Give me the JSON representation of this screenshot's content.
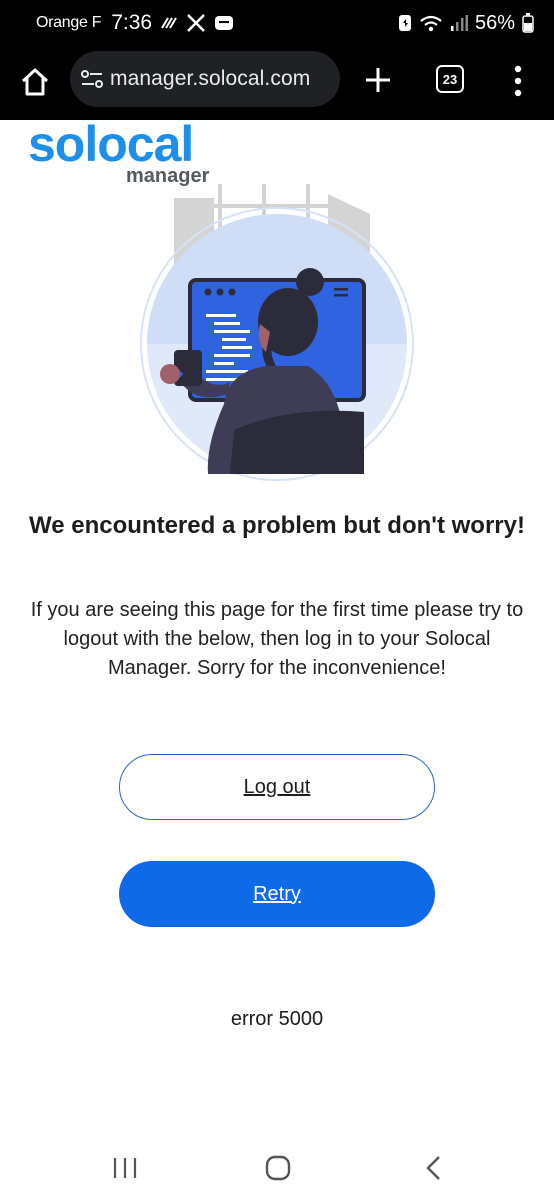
{
  "status_bar": {
    "carrier": "Orange F",
    "time": "7:36",
    "battery": "56%"
  },
  "browser": {
    "url": "manager.solocal.com",
    "tab_count": "23"
  },
  "logo": {
    "brand": "solocal",
    "product": "manager"
  },
  "error_page": {
    "heading": "We encountered a problem but don't worry!",
    "message": "If you are seeing this page for the first time please try to logout with the below, then log in to your Solocal Manager. Sorry for the inconvenience!",
    "logout_label": "Log out",
    "retry_label": "Retry",
    "error_code": "error 5000"
  },
  "colors": {
    "brand_blue": "#1e8fe8",
    "button_primary": "#0f6ae8",
    "button_outline": "#2a63c5",
    "illustration_screen": "#2f63e0"
  },
  "icons": {
    "toolbar": [
      "home-icon",
      "site-settings-icon",
      "new-tab-icon",
      "tab-switcher-icon",
      "more-menu-icon"
    ],
    "navigation": [
      "recents-icon",
      "home-nav-icon",
      "back-icon"
    ]
  }
}
